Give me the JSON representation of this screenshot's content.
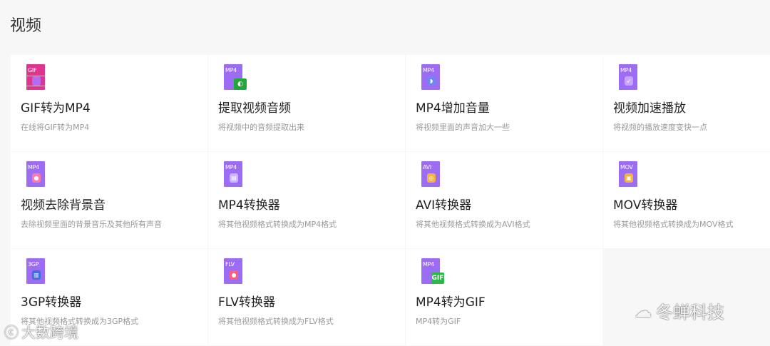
{
  "section": {
    "title": "视频"
  },
  "tools": [
    {
      "ext": "GIF",
      "title": "GIF转为MP4",
      "desc": "在线将GIF转为MP4",
      "color": "#e0358f",
      "icon": "gif-file-icon",
      "glyph_color": "#b46df2"
    },
    {
      "ext": "MP4",
      "title": "提取视频音频",
      "desc": "将视频中的音频提取出来",
      "color": "#9d6cf5",
      "icon": "extract-audio-file-icon",
      "badge_color": "#22a83a"
    },
    {
      "ext": "MP4",
      "title": "MP4增加音量",
      "desc": "将视频里面的声音加大一些",
      "color": "#9d6cf5",
      "icon": "volume-up-file-icon",
      "glyph_color": "#6f86f2"
    },
    {
      "ext": "MP4",
      "title": "视频加速播放",
      "desc": "将视频的播放速度变快一点",
      "color": "#9d6cf5",
      "icon": "speed-up-file-icon",
      "glyph_color": "#c7a4ff"
    },
    {
      "ext": "MP4",
      "title": "视频去除背景音",
      "desc": "去除视频里面的背景音乐及其他所有声音",
      "color": "#9d6cf5",
      "icon": "remove-bgm-file-icon",
      "glyph_color": "#ff7aa8"
    },
    {
      "ext": "MP4",
      "title": "MP4转换器",
      "desc": "将其他视频格式转换成为MP4格式",
      "color": "#9d6cf5",
      "icon": "mp4-converter-file-icon",
      "glyph_color": "#c9b6ff"
    },
    {
      "ext": "AVI",
      "title": "AVI转换器",
      "desc": "将其他视频格式转换成为AVI格式",
      "color": "#9d6cf5",
      "icon": "avi-converter-file-icon",
      "glyph_color": "#f2b43a"
    },
    {
      "ext": "MOV",
      "title": "MOV转换器",
      "desc": "将其他视频格式转换成为MOV格式",
      "color": "#9d6cf5",
      "icon": "mov-converter-file-icon",
      "glyph_color": "#f2b43a"
    },
    {
      "ext": "3GP",
      "title": "3GP转换器",
      "desc": "将其他视频格式转换成为3GP格式",
      "color": "#9d6cf5",
      "icon": "3gp-converter-file-icon",
      "glyph_color": "#3b6fe0"
    },
    {
      "ext": "FLV",
      "title": "FLV转换器",
      "desc": "将其他视频格式转换成为FLV格式",
      "color": "#9d6cf5",
      "icon": "flv-converter-file-icon",
      "glyph_color": "#ff5f7a"
    },
    {
      "ext": "MP4",
      "title": "MP4转为GIF",
      "desc": "MP4转为GIF",
      "color": "#9d6cf5",
      "icon": "mp4-to-gif-file-icon",
      "badge_color": "#2db84a",
      "badge_text": "GIF"
    }
  ],
  "watermarks": {
    "left": "大数跨境",
    "right": "冬蝉科技"
  }
}
